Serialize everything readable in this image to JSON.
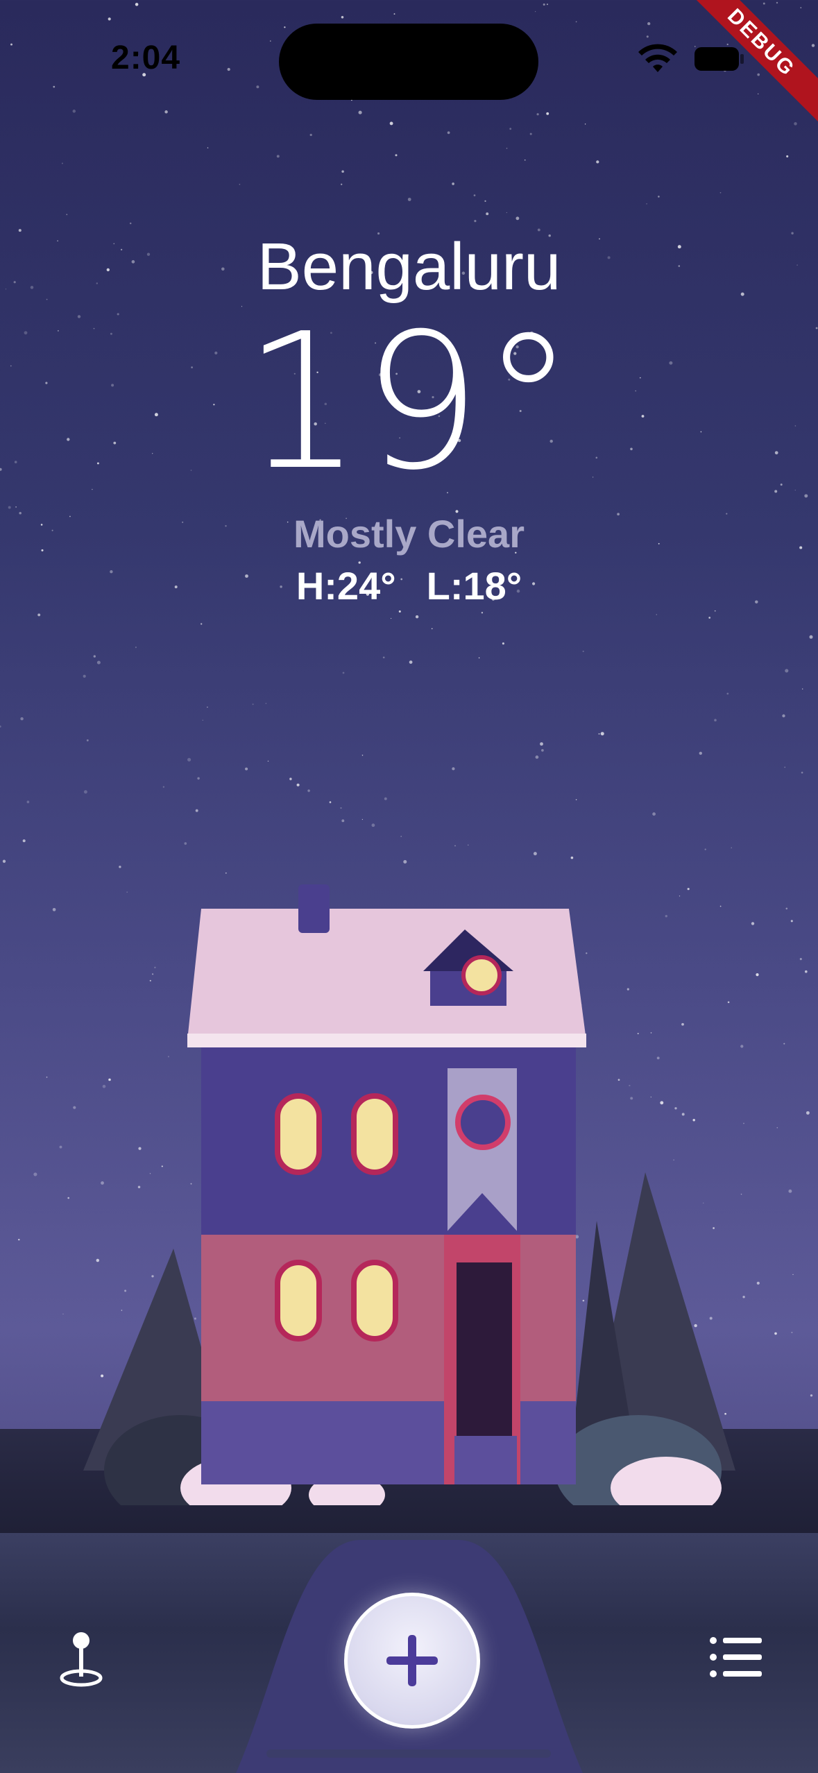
{
  "status_bar": {
    "time": "2:04",
    "debug_label": "DEBUG"
  },
  "weather": {
    "city": "Bengaluru",
    "temperature": "19°",
    "condition": "Mostly Clear",
    "high": "H:24°",
    "low": "L:18°"
  },
  "tab_bar": {
    "left_icon": "location-pin-icon",
    "center_icon": "plus-icon",
    "right_icon": "list-icon"
  },
  "colors": {
    "sky_top": "#2a2a5c",
    "sky_bottom": "#5d5a98",
    "accent": "#4b3b9a",
    "debug_red": "#b0141e"
  }
}
